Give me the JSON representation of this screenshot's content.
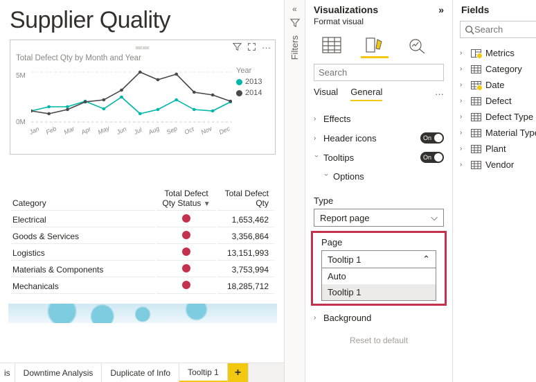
{
  "canvas": {
    "title": "Supplier Quality"
  },
  "chart_data": {
    "type": "line",
    "title": "Total Defect Qty by Month and Year",
    "legend_title": "Year",
    "categories": [
      "Jan",
      "Feb",
      "Mar",
      "Apr",
      "May",
      "Jun",
      "Jul",
      "Aug",
      "Sep",
      "Oct",
      "Nov",
      "Dec"
    ],
    "series": [
      {
        "name": "2013",
        "color": "#00b8a9",
        "values": [
          1.1,
          1.5,
          1.5,
          2.1,
          1.3,
          2.5,
          0.8,
          1.2,
          2.2,
          1.2,
          1.1,
          2.0
        ]
      },
      {
        "name": "2014",
        "color": "#4a4a4a",
        "values": [
          1.1,
          0.8,
          1.2,
          2.0,
          2.2,
          3.2,
          5.0,
          4.2,
          4.8,
          3.0,
          2.7,
          2.1
        ]
      }
    ],
    "ylabel": "",
    "ylim": [
      0,
      5000000
    ],
    "ytick_labels": [
      "0M",
      "5M"
    ]
  },
  "table": {
    "columns": [
      "Category",
      "Total Defect Qty Status",
      "Total Defect Qty"
    ],
    "sort_indicator": "▼",
    "rows": [
      {
        "category": "Electrical",
        "qty": "1,653,462"
      },
      {
        "category": "Goods & Services",
        "qty": "3,356,864"
      },
      {
        "category": "Logistics",
        "qty": "13,151,993"
      },
      {
        "category": "Materials & Components",
        "qty": "3,753,994"
      },
      {
        "category": "Mechanicals",
        "qty": "18,285,712"
      }
    ]
  },
  "tabs": {
    "stub": "is",
    "items": [
      "Downtime Analysis",
      "Duplicate of Info",
      "Tooltip 1"
    ],
    "active": "Tooltip 1",
    "add": "+"
  },
  "filters": {
    "label": "Filters"
  },
  "viz": {
    "title": "Visualizations",
    "subtitle": "Format visual",
    "search_placeholder": "Search",
    "tab_visual": "Visual",
    "tab_general": "General",
    "more": "···",
    "sections": {
      "effects": "Effects",
      "header_icons": "Header icons",
      "tooltips": "Tooltips",
      "options": "Options",
      "background": "Background"
    },
    "toggle_on": "On",
    "type_label": "Type",
    "type_value": "Report page",
    "page_label": "Page",
    "page_value": "Tooltip 1",
    "page_options": [
      "Auto",
      "Tooltip 1"
    ],
    "reset": "Reset to default"
  },
  "fields": {
    "title": "Fields",
    "search_placeholder": "Search",
    "items": [
      {
        "name": "Metrics",
        "badge": true,
        "icon": "metrics"
      },
      {
        "name": "Category",
        "badge": false,
        "icon": "table"
      },
      {
        "name": "Date",
        "badge": true,
        "icon": "table"
      },
      {
        "name": "Defect",
        "badge": false,
        "icon": "table"
      },
      {
        "name": "Defect Type",
        "badge": false,
        "icon": "table"
      },
      {
        "name": "Material Type",
        "badge": false,
        "icon": "table"
      },
      {
        "name": "Plant",
        "badge": false,
        "icon": "table"
      },
      {
        "name": "Vendor",
        "badge": false,
        "icon": "table"
      }
    ]
  }
}
